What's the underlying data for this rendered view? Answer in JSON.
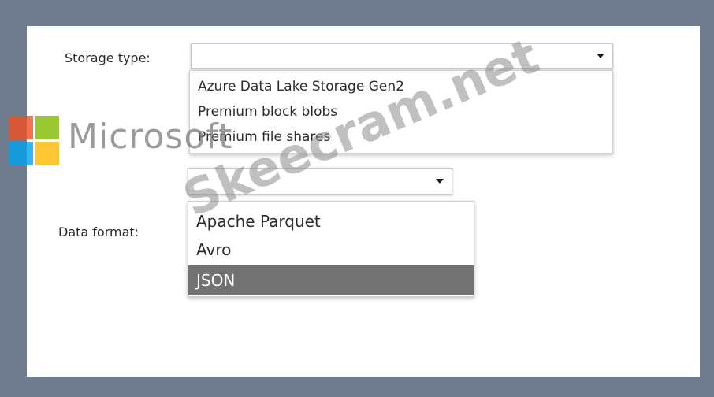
{
  "storage": {
    "label": "Storage type:",
    "options": [
      "Azure Data Lake Storage Gen2",
      "Premium block blobs",
      "Premium file shares"
    ]
  },
  "format": {
    "label": "Data format:",
    "options": [
      "Apache Parquet",
      "Avro",
      "JSON"
    ],
    "selected": "JSON"
  },
  "watermark": {
    "logo_text": "Microsoft",
    "site_text": "Skeecram.net"
  },
  "colors": {
    "frame": "#6f7c8e",
    "selected_bg": "#727272",
    "logo_red": "#f25022",
    "logo_green": "#7fba00",
    "logo_blue": "#00a4ef",
    "logo_yellow": "#ffb900"
  },
  "icons": [
    "dropdown-arrow-icon",
    "microsoft-logo-icon"
  ]
}
